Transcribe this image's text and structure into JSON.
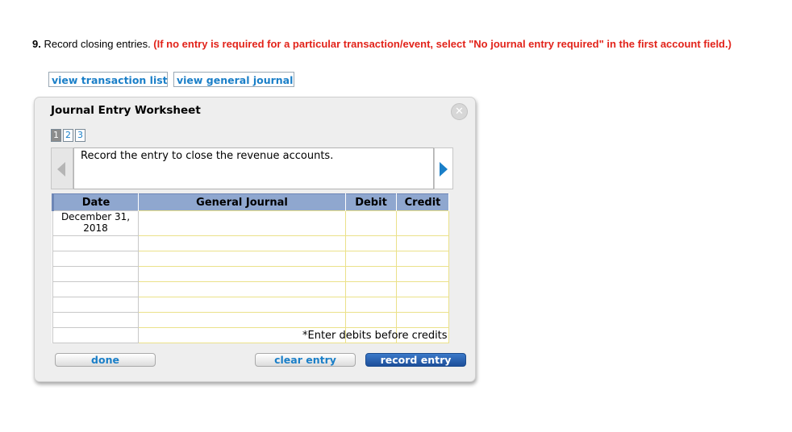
{
  "question": {
    "number": "9.",
    "text": " Record closing entries. ",
    "instruction": "(If no entry is required for a particular transaction/event, select \"No journal entry required\" in the first account field.)"
  },
  "links": {
    "view_transaction_list": "view transaction list",
    "view_general_journal": "view general journal"
  },
  "worksheet": {
    "title": "Journal Entry Worksheet",
    "close_symbol": "✕",
    "pages": [
      "1",
      "2",
      "3"
    ],
    "current_page": 1,
    "description": "Record the entry to close the revenue accounts.",
    "columns": {
      "date": "Date",
      "general_journal": "General Journal",
      "debit": "Debit",
      "credit": "Credit"
    },
    "rows": [
      {
        "date": "December 31, 2018",
        "account": "",
        "debit": "",
        "credit": ""
      },
      {
        "date": "",
        "account": "",
        "debit": "",
        "credit": ""
      },
      {
        "date": "",
        "account": "",
        "debit": "",
        "credit": ""
      },
      {
        "date": "",
        "account": "",
        "debit": "",
        "credit": ""
      },
      {
        "date": "",
        "account": "",
        "debit": "",
        "credit": ""
      },
      {
        "date": "",
        "account": "",
        "debit": "",
        "credit": ""
      },
      {
        "date": "",
        "account": "",
        "debit": "",
        "credit": ""
      },
      {
        "date": "",
        "account": "",
        "debit": "",
        "credit": ""
      }
    ],
    "note": "*Enter debits before credits",
    "buttons": {
      "done": "done",
      "clear_entry": "clear entry",
      "record_entry": "record entry"
    }
  },
  "colors": {
    "instruction_red": "#e2231a",
    "link_blue": "#1a7fc8",
    "header_blue": "#8fa7cf",
    "record_button": "#2a62b0"
  }
}
